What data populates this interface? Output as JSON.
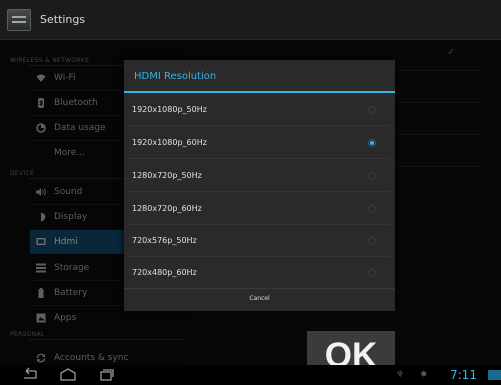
{
  "header": {
    "title": "Settings"
  },
  "sidebar": {
    "sections": [
      "WIRELESS & NETWORKS",
      "DEVICE",
      "PERSONAL"
    ],
    "items": [
      {
        "label": "Wi-Fi",
        "icon": "wifi-icon"
      },
      {
        "label": "Bluetooth",
        "icon": "bluetooth-icon"
      },
      {
        "label": "Data usage",
        "icon": "data-usage-icon"
      },
      {
        "label": "More...",
        "icon": ""
      },
      {
        "label": "Sound",
        "icon": "sound-icon"
      },
      {
        "label": "Display",
        "icon": "display-icon"
      },
      {
        "label": "Hdmi",
        "icon": "hdmi-icon"
      },
      {
        "label": "Storage",
        "icon": "storage-icon"
      },
      {
        "label": "Battery",
        "icon": "battery-icon"
      },
      {
        "label": "Apps",
        "icon": "apps-icon"
      },
      {
        "label": "Accounts & sync",
        "icon": "sync-icon"
      }
    ],
    "active_item": "Hdmi"
  },
  "dialog": {
    "title": "HDMI Resolution",
    "options": [
      {
        "label": "1920x1080p_50Hz",
        "selected": false
      },
      {
        "label": "1920x1080p_60Hz",
        "selected": true
      },
      {
        "label": "1280x720p_50Hz",
        "selected": false
      },
      {
        "label": "1280x720p_60Hz",
        "selected": false
      },
      {
        "label": "720x576p_50Hz",
        "selected": false
      },
      {
        "label": "720x480p_60Hz",
        "selected": false
      }
    ],
    "cancel_label": "Cancel"
  },
  "ok_overlay": {
    "label": "OK"
  },
  "statusbar": {
    "time": "7:11"
  },
  "colors": {
    "accent": "#33b5e5",
    "active_item_bg": "#0f4a68",
    "dialog_bg": "#2a2a2a"
  }
}
